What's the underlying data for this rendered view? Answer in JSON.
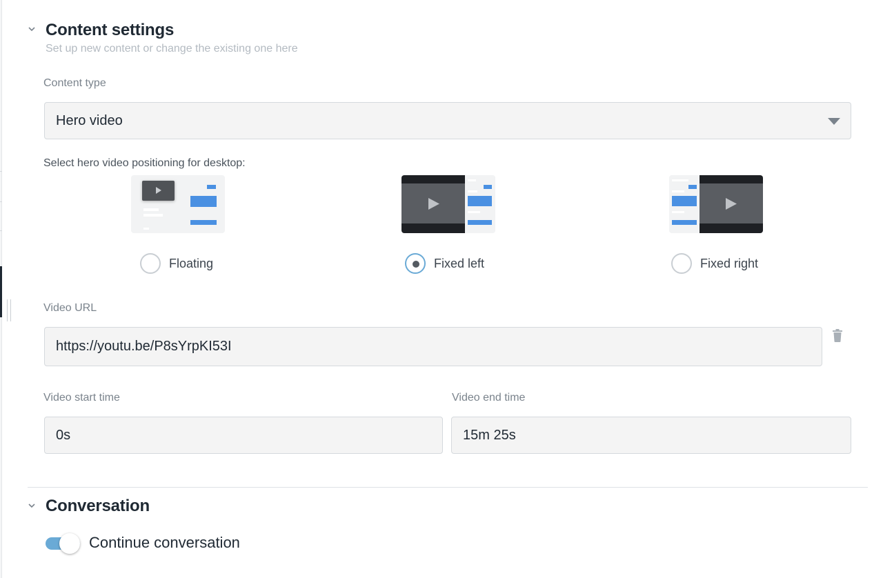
{
  "content_settings": {
    "title": "Content settings",
    "subtitle": "Set up new content or change the existing one here",
    "content_type": {
      "label": "Content type",
      "selected": "Hero video"
    },
    "positioning": {
      "label": "Select hero video positioning for desktop:",
      "options": [
        {
          "label": "Floating",
          "checked": false
        },
        {
          "label": "Fixed left",
          "checked": true
        },
        {
          "label": "Fixed right",
          "checked": false
        }
      ]
    },
    "video_url": {
      "label": "Video URL",
      "value": "https://youtu.be/P8sYrpKI53I"
    },
    "video_start": {
      "label": "Video start time",
      "value": "0s"
    },
    "video_end": {
      "label": "Video end time",
      "value": "15m 25s"
    }
  },
  "conversation": {
    "title": "Conversation",
    "continue_label": "Continue conversation",
    "continue_enabled": true
  },
  "colors": {
    "accent": "#6aaad6",
    "thumb_blue": "#4a90e2",
    "video_dark": "#2b2d31"
  },
  "icons": {
    "section_toggle": "chevron-down-icon",
    "delete": "trash-icon",
    "play": "play-icon"
  }
}
